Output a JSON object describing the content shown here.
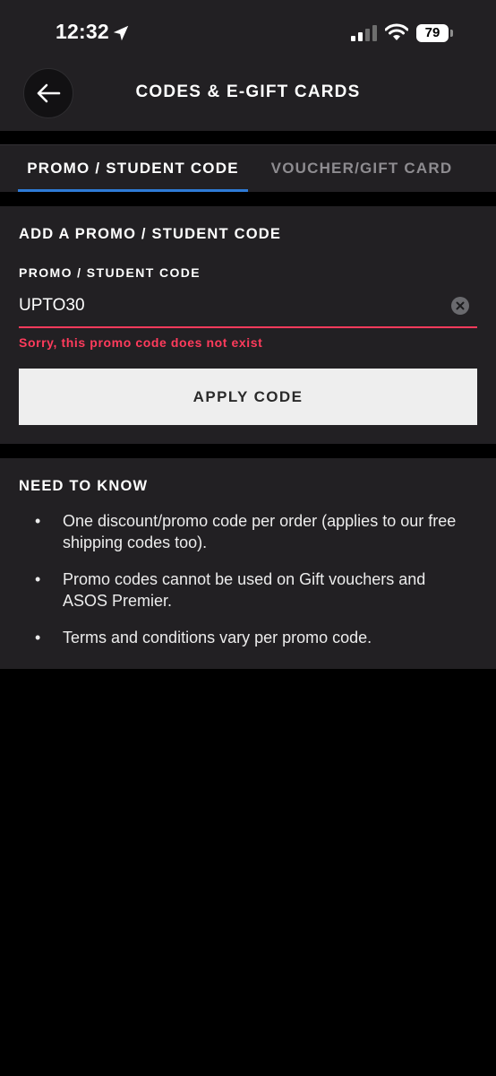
{
  "status_bar": {
    "time": "12:32",
    "battery": "79",
    "icons": [
      "location-arrow-icon",
      "signal-icon",
      "wifi-icon",
      "battery-icon"
    ]
  },
  "header": {
    "title": "CODES & E-GIFT CARDS",
    "back_icon": "arrow-left-icon"
  },
  "tabs": [
    {
      "label": "PROMO / STUDENT CODE",
      "active": true
    },
    {
      "label": "VOUCHER/GIFT CARD",
      "active": false
    }
  ],
  "promo": {
    "heading": "ADD A PROMO / STUDENT CODE",
    "field_label": "PROMO / STUDENT CODE",
    "input_value": "UPTO30",
    "error": "Sorry, this promo code does not exist",
    "apply_label": "APPLY CODE"
  },
  "info": {
    "heading": "NEED TO KNOW",
    "items": [
      "One discount/promo code per order (applies to our free shipping codes too).",
      "Promo codes cannot be used on Gift vouchers and ASOS Premier.",
      "Terms and conditions vary per promo code."
    ]
  },
  "colors": {
    "panel": "#222023",
    "background": "#000000",
    "accent_blue": "#2e7bd6",
    "error_red": "#ff3b5c",
    "button_bg": "#eeeeee"
  }
}
